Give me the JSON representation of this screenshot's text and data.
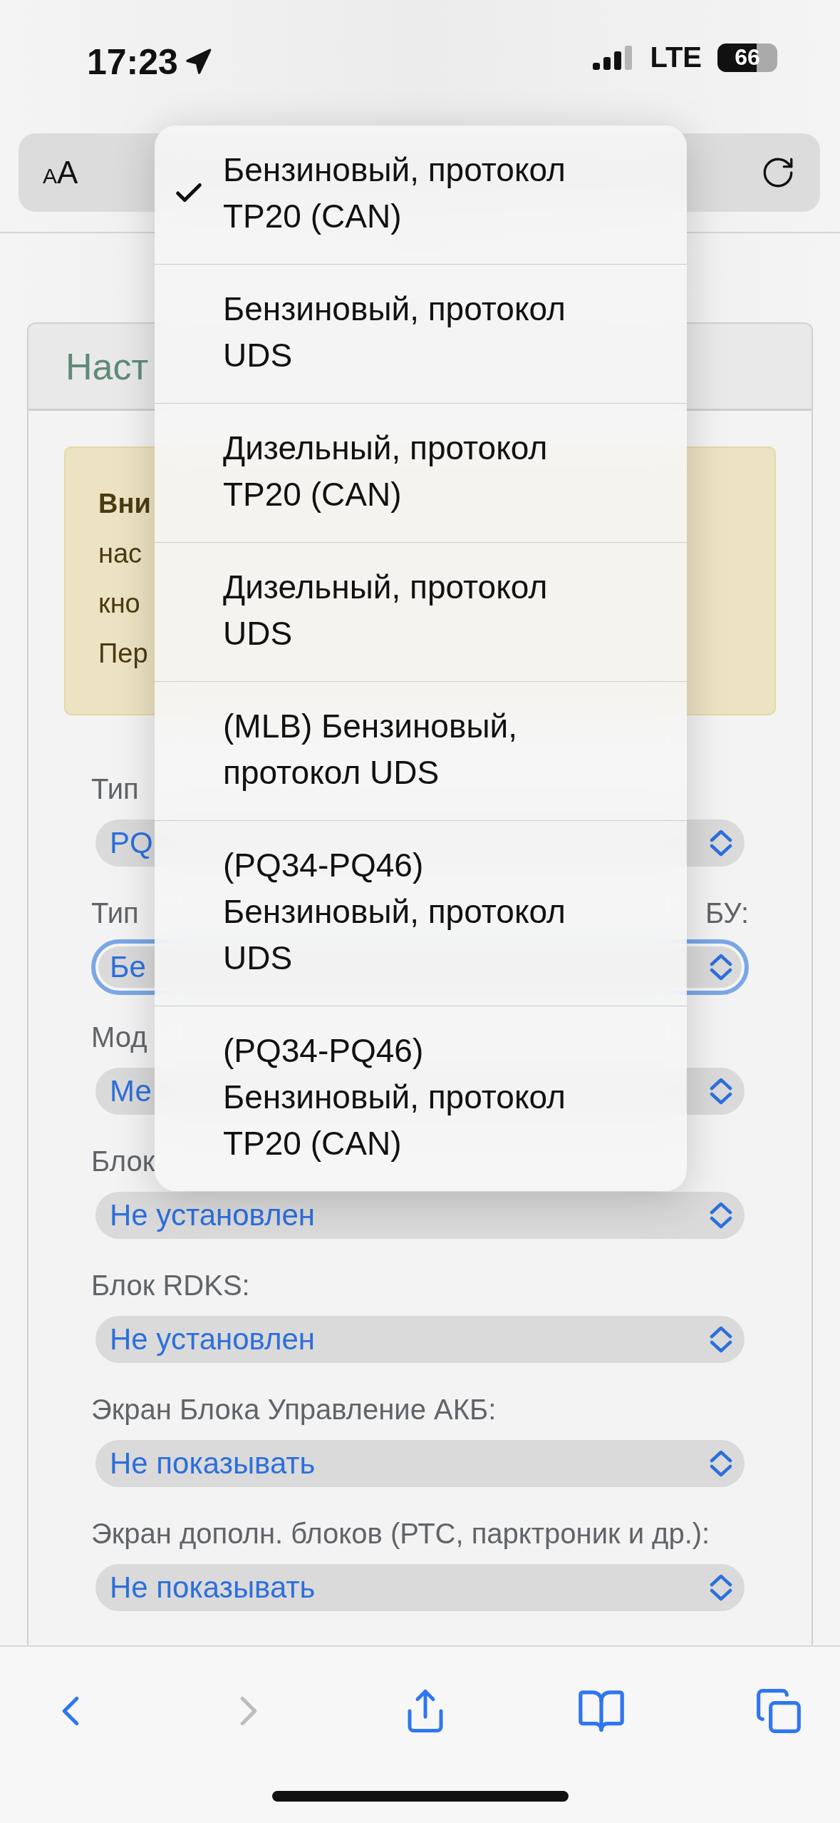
{
  "status_bar": {
    "time": "17:23",
    "network": "LTE",
    "battery": "66"
  },
  "address_bar": {
    "text_size_button": "AA"
  },
  "card": {
    "title": "Наст",
    "alert_lines": [
      {
        "text": "Вни",
        "bold": true
      },
      {
        "text": "нас",
        "bold": false
      },
      {
        "text": "кно",
        "bold": false
      },
      {
        "text": "Пер",
        "bold": false
      }
    ],
    "fields": [
      {
        "label": "Тип",
        "value": "PQ",
        "focused": false
      },
      {
        "label": "Тип",
        "label_tail": "БУ:",
        "value": "Бе",
        "focused": true
      },
      {
        "label": "Мод",
        "value": "Ме",
        "focused": false
      },
      {
        "label": "Блок",
        "value": "Не установлен",
        "focused": false
      },
      {
        "label": "Блок RDKS:",
        "value": "Не установлен",
        "focused": false
      },
      {
        "label": "Экран Блока Управление АКБ:",
        "value": "Не показывать",
        "focused": false
      },
      {
        "label": "Экран дополн. блоков (РТС, парктроник и др.):",
        "value": "Не показывать",
        "focused": false
      }
    ]
  },
  "dropdown": {
    "options": [
      {
        "label": "Бензиновый, протокол TP20 (CAN)",
        "selected": true
      },
      {
        "label": "Бензиновый, протокол UDS",
        "selected": false
      },
      {
        "label": "Дизельный, протокол TP20 (CAN)",
        "selected": false
      },
      {
        "label": "Дизельный, протокол UDS",
        "selected": false
      },
      {
        "label": "(MLB) Бензиновый, протокол UDS",
        "selected": false
      },
      {
        "label": "(PQ34-PQ46) Бензиновый, протокол UDS",
        "selected": false
      },
      {
        "label": "(PQ34-PQ46) Бензиновый, протокол TP20 (CAN)",
        "selected": false
      }
    ]
  },
  "toolbar": {
    "back_enabled": true,
    "forward_enabled": false
  }
}
